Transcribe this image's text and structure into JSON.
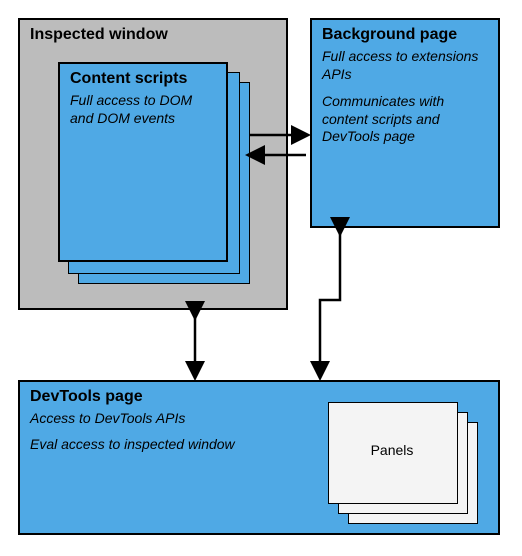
{
  "inspected_window": {
    "title": "Inspected window"
  },
  "content_scripts": {
    "title": "Content scripts",
    "desc": "Full access to DOM and DOM events"
  },
  "background_page": {
    "title": "Background page",
    "desc1": "Full access to extensions APIs",
    "desc2": "Communicates with content scripts and DevTools page"
  },
  "devtools_page": {
    "title": "DevTools page",
    "desc1": "Access to DevTools APIs",
    "desc2": "Eval access to inspected window"
  },
  "panels": {
    "label": "Panels"
  }
}
